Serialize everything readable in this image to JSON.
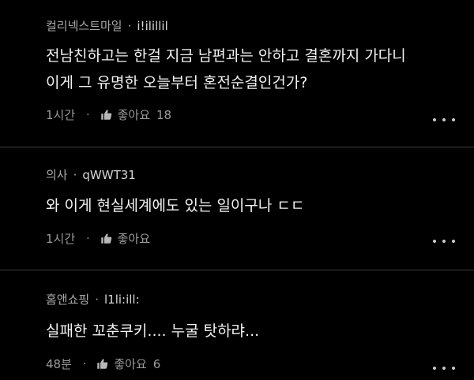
{
  "comments": [
    {
      "community": "컬리넥스트마일",
      "handle": "i!ilillil",
      "lines": [
        "전남친하고는 한걸 지금 남편과는 안하고 결혼까지 가다니",
        "이게 그 유명한 오늘부터 혼전순결인건가?"
      ],
      "time": "1시간",
      "like_label": "좋아요",
      "like_count": "18"
    },
    {
      "community": "의사",
      "handle": "qWWT31",
      "lines": [
        "와 이게 현실세계에도 있는 일이구나 ㄷㄷ"
      ],
      "time": "1시간",
      "like_label": "좋아요",
      "like_count": ""
    },
    {
      "community": "홈앤쇼핑",
      "handle": "l1li:ill:",
      "lines": [
        "실패한 꼬춘쿠키.... 누굴 탓하랴..."
      ],
      "time": "48분",
      "like_label": "좋아요",
      "like_count": "6"
    }
  ],
  "separator": "·",
  "icons": {
    "like": "thumbs-up-icon",
    "more": "more-horizontal-icon"
  },
  "colors": {
    "background": "#000000",
    "primary_text": "#f2f2f2",
    "secondary_text": "#a9a9a9"
  }
}
